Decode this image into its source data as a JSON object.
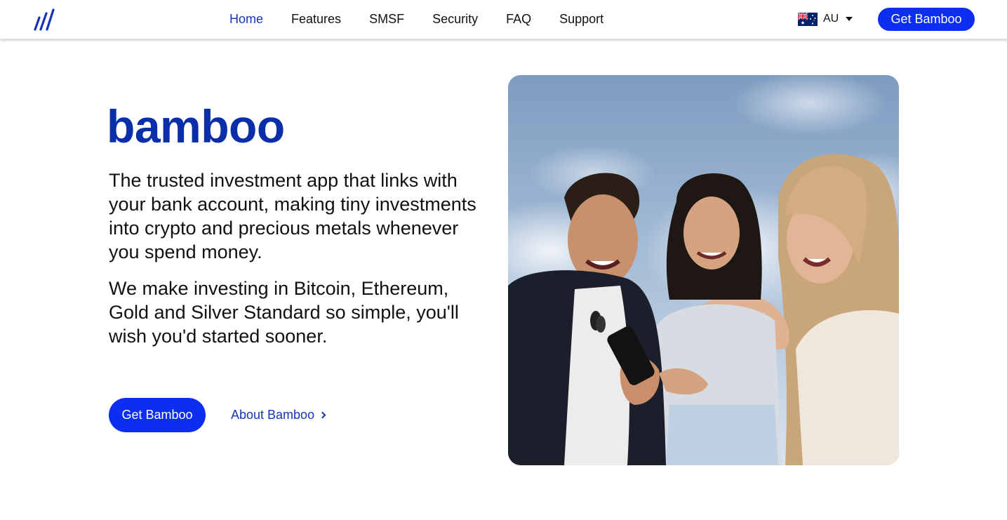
{
  "header": {
    "logo_icon": "bamboo-slashes-logo",
    "nav": [
      {
        "label": "Home",
        "active": true
      },
      {
        "label": "Features",
        "active": false
      },
      {
        "label": "SMSF",
        "active": false
      },
      {
        "label": "Security",
        "active": false
      },
      {
        "label": "FAQ",
        "active": false
      },
      {
        "label": "Support",
        "active": false
      }
    ],
    "locale": {
      "flag_icon": "australia-flag-icon",
      "label": "AU",
      "caret_icon": "caret-down-icon"
    },
    "cta_label": "Get Bamboo"
  },
  "hero": {
    "brand": "bamboo",
    "paragraph_1": "The trusted investment app that links with your bank account, making tiny investments into crypto and precious metals whenever you spend money.",
    "paragraph_2": "We make investing in Bitcoin, Ethereum, Gold and Silver Standard so simple, you'll wish you'd started sooner.",
    "cta_label": "Get Bamboo",
    "about_label": "About Bamboo",
    "about_icon": "chevron-right-icon"
  },
  "colors": {
    "brand_blue": "#0a2fa8",
    "nav_active": "#1634b8",
    "button_blue": "#0c2ef0"
  }
}
